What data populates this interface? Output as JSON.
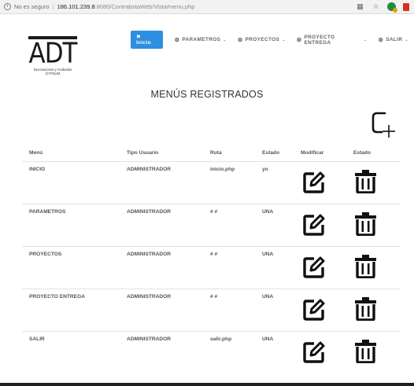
{
  "browser": {
    "security_label": "No es seguro",
    "url_host": "186.101.239.8",
    "url_path": ":8080/ContrabstaWeb/Vista/menu.php"
  },
  "logo": {
    "brand": "ADT",
    "tagline1": "Decoraciones y Acabados",
    "tagline2": "GYPSUM"
  },
  "nav": {
    "items": [
      {
        "label": "Inicio",
        "icon": "home-icon"
      },
      {
        "label": "PARAMETROS",
        "icon": "gear-icon"
      },
      {
        "label": "PROYECTOS",
        "icon": "gear-icon"
      },
      {
        "label": "PROYECTO ENTREGA",
        "icon": "gear-icon"
      },
      {
        "label": "SALIR",
        "icon": "gear-icon"
      }
    ]
  },
  "page": {
    "title": "MENÚS REGISTRADOS"
  },
  "table": {
    "columns": [
      "Menú",
      "Tipo Usuario",
      "Ruta",
      "Estado",
      "Modificar",
      "Estado"
    ],
    "rows": [
      {
        "menu": "INICIO",
        "tipo": "ADMINISTRADOR",
        "ruta": "inicio.php",
        "estado": "yo"
      },
      {
        "menu": "PARAMETROS",
        "tipo": "ADMINISTRADOR",
        "ruta": "# #",
        "estado": "UNA"
      },
      {
        "menu": "PROYECTOS",
        "tipo": "ADMINISTRADOR",
        "ruta": "# #",
        "estado": "UNA"
      },
      {
        "menu": "PROYECTO ENTREGA",
        "tipo": "ADMINISTRADOR",
        "ruta": "# #",
        "estado": "UNA"
      },
      {
        "menu": "SALIR",
        "tipo": "ADMINISTRADOR",
        "ruta": "salir.php",
        "estado": "UNA"
      }
    ]
  },
  "colors": {
    "nav_active": "#2d8fe0",
    "text": "#555555"
  }
}
